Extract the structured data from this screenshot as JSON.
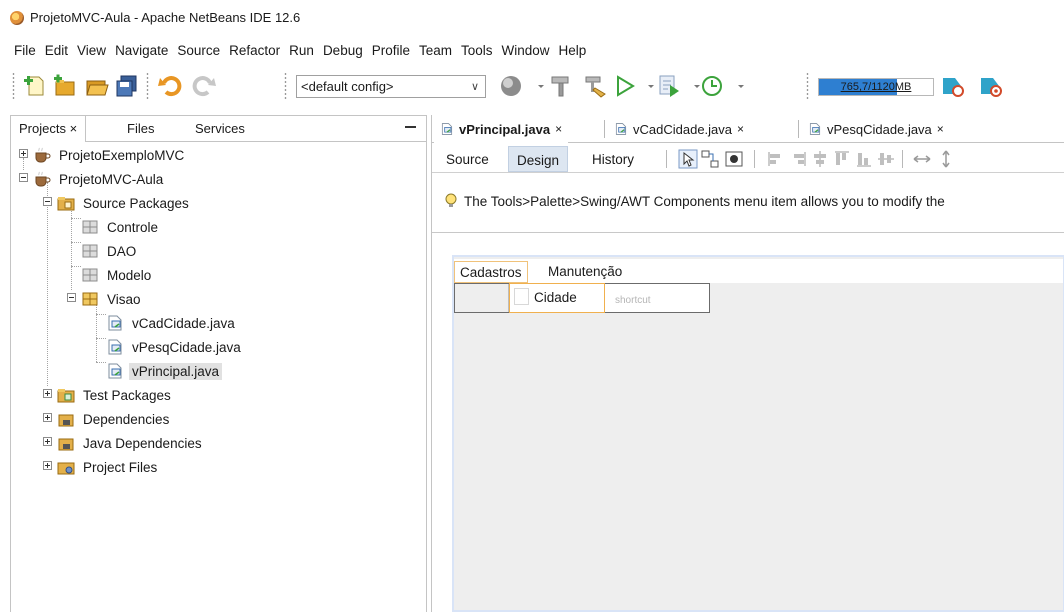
{
  "window": {
    "title": "ProjetoMVC-Aula - Apache NetBeans IDE 12.6"
  },
  "menubar": [
    "File",
    "Edit",
    "View",
    "Navigate",
    "Source",
    "Refactor",
    "Run",
    "Debug",
    "Profile",
    "Team",
    "Tools",
    "Window",
    "Help"
  ],
  "toolbar": {
    "config_select": "<default config>",
    "memory": {
      "label": "765,7/1120MB",
      "used_fraction": 0.68
    }
  },
  "projects_panel": {
    "tabs": [
      "Projects",
      "Files",
      "Services"
    ],
    "close_glyph": "×",
    "tree": {
      "project_1": "ProjetoExemploMVC",
      "project_2": "ProjetoMVC-Aula",
      "source_packages": "Source Packages",
      "pkg_controle": "Controle",
      "pkg_dao": "DAO",
      "pkg_modelo": "Modelo",
      "pkg_visao": "Visao",
      "file_1": "vCadCidade.java",
      "file_2": "vPesqCidade.java",
      "file_3": "vPrincipal.java",
      "test_packages": "Test Packages",
      "dependencies": "Dependencies",
      "java_dependencies": "Java Dependencies",
      "project_files": "Project Files"
    }
  },
  "editor": {
    "tabs": [
      "vPrincipal.java",
      "vCadCidade.java",
      "vPesqCidade.java"
    ],
    "close_glyph": "×",
    "subtabs": [
      "Source",
      "Design",
      "History"
    ],
    "hint": "The Tools>Palette>Swing/AWT Components menu item allows you to modify the",
    "form": {
      "menus": [
        "Cadastros",
        "Manutenção"
      ],
      "popup_item": "Cidade",
      "shortcut": "shortcut"
    }
  },
  "colors": {
    "accent": "#2e7fd1",
    "selection_orange": "#f0b04e",
    "design_tab": "#dde6f1"
  }
}
